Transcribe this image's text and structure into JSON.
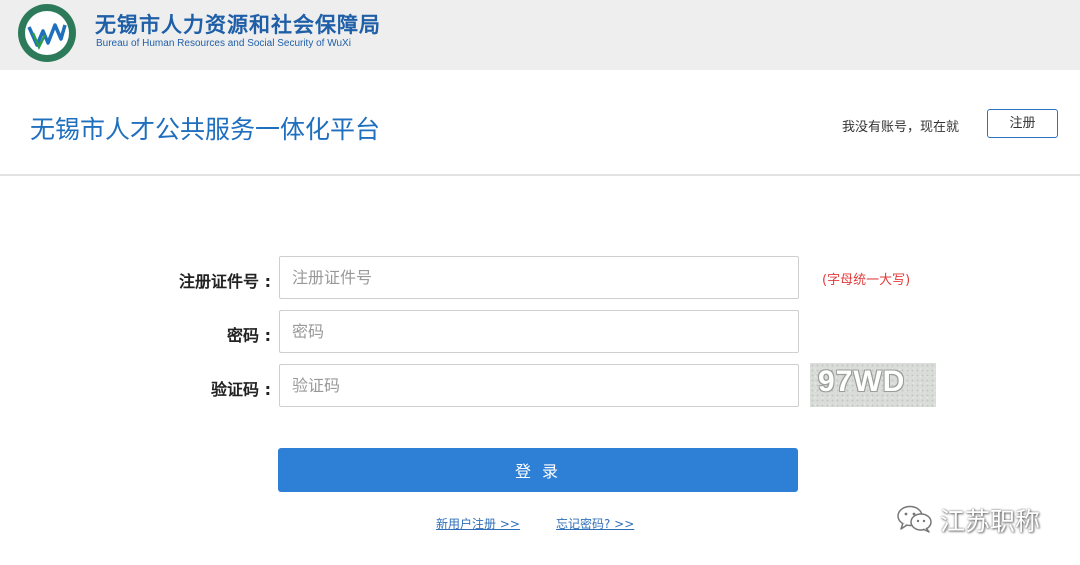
{
  "bureau": {
    "name_cn": "无锡市人力资源和社会保障局",
    "name_en": "Bureau of Human Resources and Social Security of WuXi"
  },
  "header": {
    "platform_title": "无锡市人才公共服务一体化平台",
    "no_account_text": "我没有账号，现在就",
    "register_button": "注册"
  },
  "form": {
    "cert_label": "注册证件号 :",
    "cert_placeholder": "注册证件号",
    "cert_hint": "(字母统一大写)",
    "password_label": "密码 :",
    "password_placeholder": "密码",
    "captcha_label": "验证码 :",
    "captcha_placeholder": "验证码",
    "captcha_text": "97WD",
    "login_button": "登 录"
  },
  "links": {
    "new_user": "新用户注册 >>",
    "forgot_password": "忘记密码? >>"
  },
  "watermark": {
    "text": "江苏职称",
    "icon": "wechat-icon"
  },
  "colors": {
    "brand_blue": "#1f6fbf",
    "button_blue": "#2e7fd6",
    "hint_red": "#e23b3b"
  }
}
